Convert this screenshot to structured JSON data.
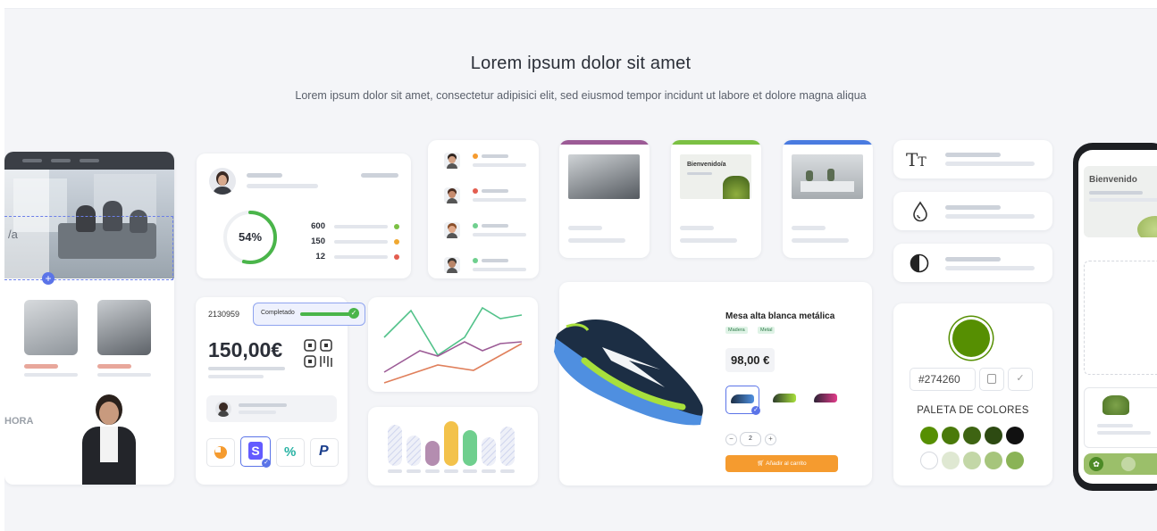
{
  "header": {
    "title": "Lorem ipsum dolor sit amet",
    "subtitle": "Lorem ipsum dolor sit amet, consectetur adipisici elit, sed eiusmod tempor incidunt ut labore et dolore magna aliqua"
  },
  "left_panel": {
    "partial_label_a": "/a",
    "partial_label_b": "HORA"
  },
  "progress_card": {
    "percent_label": "54%",
    "percent": 54,
    "rows": [
      {
        "value": "600",
        "color": "#7bc043"
      },
      {
        "value": "150",
        "color": "#f0a830"
      },
      {
        "value": "12",
        "color": "#e35d4f"
      }
    ]
  },
  "order_card": {
    "order_id": "2130959",
    "status_label": "Completado",
    "amount": "150,00€"
  },
  "photo_cards": [
    {
      "accent": "#9c5b96"
    },
    {
      "accent": "#7bc043",
      "label": "Bienvenido/a"
    },
    {
      "accent": "#4a7be0"
    }
  ],
  "product": {
    "name": "Mesa alta blanca metálica",
    "tags": [
      "Madera",
      "Metal"
    ],
    "price": "98,00 €",
    "quantity": "2",
    "cart_button": "Añadir al carrito",
    "cart_color": "#f59b2f"
  },
  "palette": {
    "hex_value": "#274260",
    "title": "PALETA DE COLORES",
    "selected_color": "#568f02",
    "swatches_row1": [
      "#568f02",
      "#4a7a0a",
      "#3e6412",
      "#2d4a12",
      "#111111"
    ],
    "swatches_row2": [
      "#ffffff",
      "#dfe8d2",
      "#c3d7a7",
      "#a6c57c",
      "#8ab356"
    ]
  },
  "phone": {
    "welcome": "Bienvenido"
  },
  "colors": {
    "accent_blue": "#5b74e8",
    "green": "#4ab54a"
  }
}
